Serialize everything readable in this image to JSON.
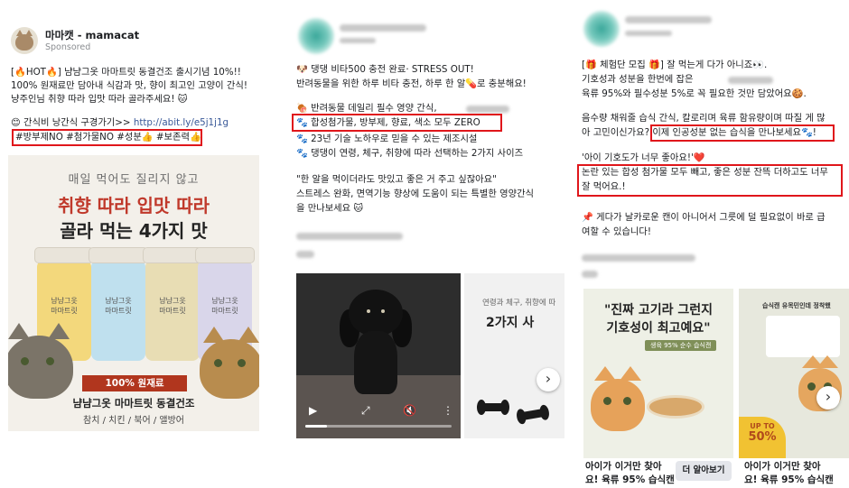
{
  "post1": {
    "page_name": "마마캣 - mamacat",
    "sponsored": "Sponsored",
    "lines": [
      "[🔥HOT🔥] 냠냠그옷 마마트릿 동결건조 출시기념 10%!!",
      "100% 원재료만 담아내 식감과 맛, 향이 최고인 고양이 간식!",
      "냥주인님 취향 따라 입맛 따라 골라주세요! 🐱"
    ],
    "link_prefix": "😊 간식비 낭간식 구경가기>> ",
    "link_url": "http://abit.ly/e5j1j1g",
    "hashtags": "#방부제NO #첨가물NO #성분👍 #보존력👍",
    "image": {
      "headline1": "매일 먹어도 질리지 않고",
      "headline2": "취향 따라 입맛 따라",
      "headline3": "골라 먹는 4가지 맛",
      "jar_labels": [
        "냠냠그옷\n마마트릿",
        "냠냠그옷\n마마트릿",
        "냠냠그옷\n마마트릿",
        "냠냠그옷\n마마트릿"
      ],
      "badge": "100% 원재료",
      "product_name": "냠냠그옷 마마트릿 동결건조",
      "flavors": "참치 / 치킨 / 북어 / 앨방어"
    }
  },
  "post2": {
    "lines": [
      "🐶 댕댕 비타500 충전 완료· STRESS OUT!",
      "반려동물을 위한 하루 비타 충전, 하루 한 알💊로 충분해요!"
    ],
    "bullets": [
      "🍖 반려동물 데일리 필수 영양 간식,",
      "🐾 합성첨가물, 방부제, 향료, 색소 모두 ZERO",
      "🐾 23년 기술 노하우로 믿을 수 있는 제조시설",
      "🐾 댕댕이 연령, 체구, 취향에 따라 선택하는 2가지 사이즈"
    ],
    "quote": [
      "\"한 알을 먹이더라도 맛있고 좋은 거 주고 싶잖아요\"",
      "스트레스 완화, 면역기능 향상에 도움이 되는 특별한 영양간식",
      "을 만나보세요 🐱"
    ],
    "card2_text1": "연령과 체구, 취향에 따",
    "card2_text2": "2가지 사",
    "next_icon": "›"
  },
  "post3": {
    "lines": [
      "[🎁 체험단 모집 🎁] 잘 먹는게 다가 아니죠👀.",
      "기호성과 성분을 한번에 잡은",
      "육류 95%와 필수성분 5%로 꼭 필요한 것만 담았어요🍪.",
      "",
      "음수량 채워줄 습식 간식, 칼로리며 육류 함유량이며 따질 게 많",
      "아 고민이신가요? 이제 인공성분 없는 습식을 만나보세요🐾!",
      "",
      "'아이 기호도가 너무 좋아요!'❤️",
      "논란 있는 합성 첨가물 모두 빼고, 좋은 성분 잔뜩 더하고도 너무",
      "잘 먹어요.!",
      "",
      "📌 게다가 날카로운 캔이 아니어서 그릇에 덜 필요없이 바로 급",
      "여할 수 있습니다!"
    ],
    "card_a": {
      "quote1": "\"진짜 고기라 그런지",
      "quote2": "기호성이 최고예요\"",
      "chip": "생육 95% 순수 습식캔",
      "cta1": "아이가 이거만 찾아",
      "cta2": "요! 육류 95% 습식캔",
      "button": "더 알아보기"
    },
    "card_b": {
      "title": "습식캔 유목민인데 정착했",
      "upto1": "UP TO",
      "upto2": "50%",
      "cta1": "아이가 이거만 찾아",
      "cta2": "요! 육류 95% 습식캔"
    },
    "next_icon": "›"
  },
  "colors": {
    "highlight": "#e0161b",
    "link": "#385898"
  }
}
